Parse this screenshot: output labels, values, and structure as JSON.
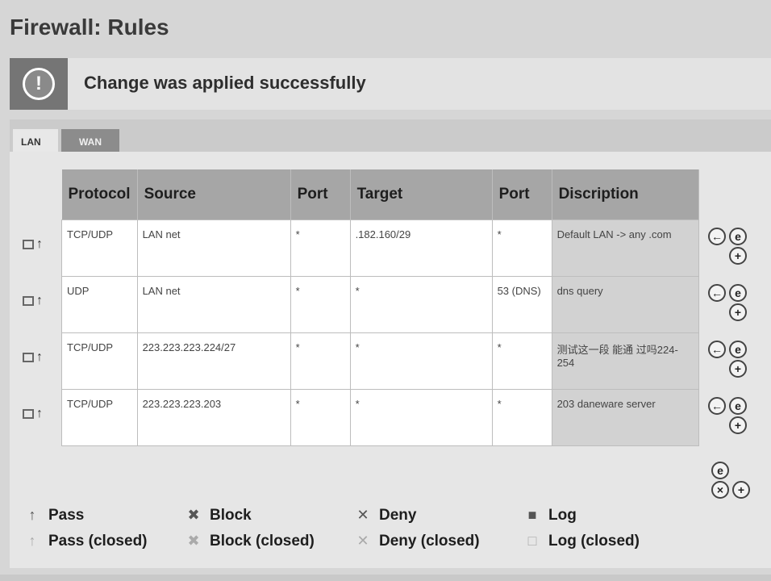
{
  "page_title": "Firewall: Rules",
  "banner": {
    "message": "Change was applied successfully",
    "icon": "exclamation-icon"
  },
  "tabs": [
    {
      "label": "LAN",
      "active": true
    },
    {
      "label": "WAN",
      "active": false
    }
  ],
  "table": {
    "headers": [
      "Protocol",
      "Source",
      "Port",
      "Target",
      "Port",
      "Discription"
    ],
    "rows": [
      {
        "protocol": "TCP/UDP",
        "source": "LAN net",
        "sport": "*",
        "target": ".182.160/29",
        "tport": "*",
        "desc": "Default LAN -> any .com"
      },
      {
        "protocol": "UDP",
        "source": "LAN net",
        "sport": "*",
        "target": "*",
        "tport": "53 (DNS)",
        "desc": "dns query"
      },
      {
        "protocol": "TCP/UDP",
        "source": "223.223.223.224/27",
        "sport": "*",
        "target": "*",
        "tport": "*",
        "desc": "测试这一段 能通 过吗224-254"
      },
      {
        "protocol": "TCP/UDP",
        "source": "223.223.223.203",
        "sport": "*",
        "target": "*",
        "tport": "*",
        "desc": "203 daneware server"
      }
    ]
  },
  "legend": {
    "pass": "Pass",
    "block": "Block",
    "deny": "Deny",
    "log": "Log",
    "pass_closed": "Pass (closed)",
    "block_closed": "Block (closed)",
    "deny_closed": "Deny (closed)",
    "log_closed": "Log (closed)"
  }
}
